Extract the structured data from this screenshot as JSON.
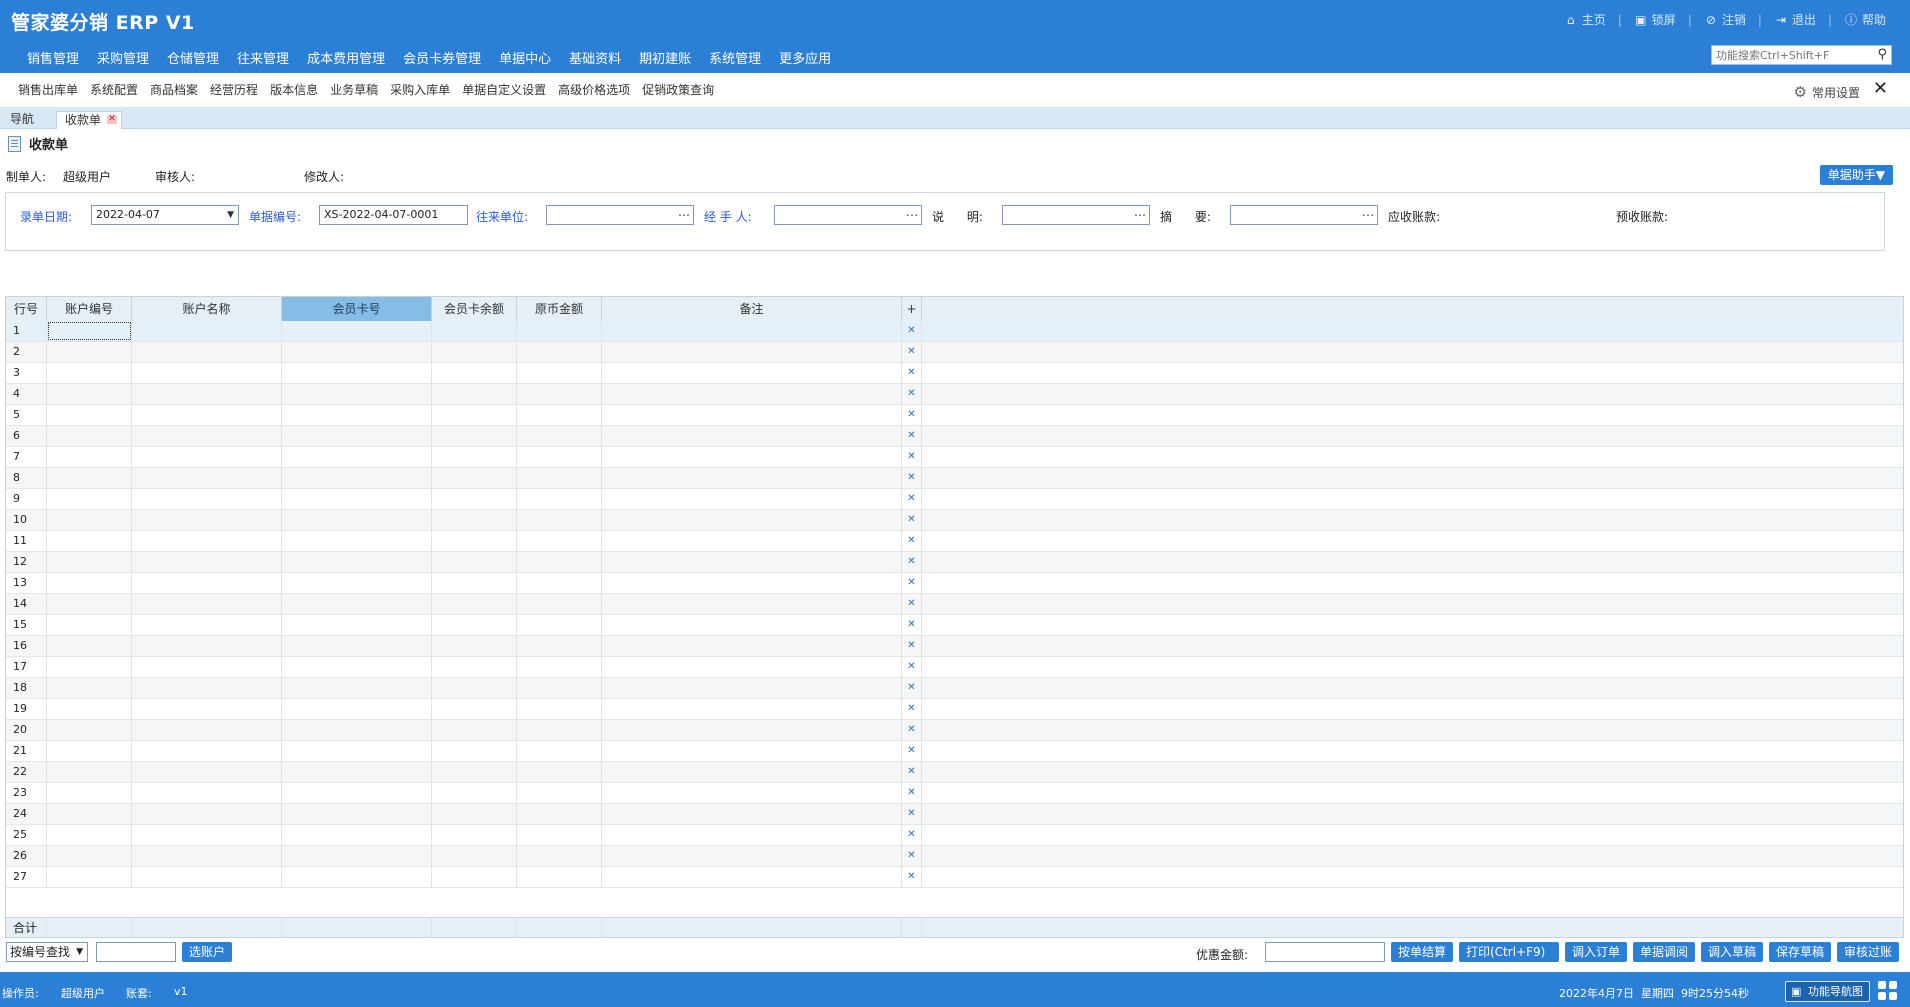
{
  "app": {
    "title": "管家婆分销 ERP V1"
  },
  "top_links": [
    {
      "label": "主页",
      "icon": "home-icon",
      "glyph": "⌂"
    },
    {
      "label": "锁屏",
      "icon": "lock-icon",
      "glyph": "🔒"
    },
    {
      "label": "注销",
      "icon": "logout-icon",
      "glyph": "⊘"
    },
    {
      "label": "退出",
      "icon": "exit-icon",
      "glyph": "⇥"
    },
    {
      "label": "帮助",
      "icon": "help-icon",
      "glyph": "ⓘ"
    }
  ],
  "main_menu": [
    "销售管理",
    "采购管理",
    "仓储管理",
    "往来管理",
    "成本费用管理",
    "会员卡券管理",
    "单据中心",
    "基础资料",
    "期初建账",
    "系统管理",
    "更多应用"
  ],
  "func_search": {
    "placeholder": "功能搜索Ctrl+Shift+F"
  },
  "quick_links": [
    "销售出库单",
    "系统配置",
    "商品档案",
    "经营历程",
    "版本信息",
    "业务草稿",
    "采购入库单",
    "单据自定义设置",
    "高级价格选项",
    "促销政策查询"
  ],
  "common_settings": {
    "label": "常用设置"
  },
  "tabs": {
    "nav": "导航",
    "active": "收款单"
  },
  "doc": {
    "title": "收款单",
    "maker_label": "制单人:",
    "maker_value": "超级用户",
    "auditor_label": "审核人:",
    "modifier_label": "修改人:",
    "helper_button": "单据助手▼"
  },
  "form": {
    "date_label": "录单日期:",
    "date_value": "2022-04-07",
    "number_label": "单据编号:",
    "number_value": "XS-2022-04-07-0001",
    "unit_label": "往来单位:",
    "handler_label": "经 手 人:",
    "note_label": "说      明:",
    "summary_label": "摘      要:",
    "receivable_label": "应收账款:",
    "prereceive_label": "预收账款:"
  },
  "grid": {
    "columns": [
      "行号",
      "账户编号",
      "账户名称",
      "会员卡号",
      "会员卡余额",
      "原币金额",
      "备注",
      "+"
    ],
    "rows": [
      "1",
      "2",
      "3",
      "4",
      "5",
      "6",
      "7",
      "8",
      "9",
      "10",
      "11",
      "12",
      "13",
      "14",
      "15",
      "16",
      "17",
      "18",
      "19",
      "20",
      "21",
      "22",
      "23",
      "24",
      "25",
      "26",
      "27"
    ],
    "delete_glyph": "✕",
    "total_label": "合计"
  },
  "bottom": {
    "lookup_select": "按编号查找",
    "select_account_btn": "选账户",
    "discount_label": "优惠金额:",
    "buttons": [
      "按单结算",
      "打印(Ctrl+F9)",
      "调入订单",
      "单据调阅",
      "调入草稿",
      "保存草稿",
      "审核过账"
    ]
  },
  "status": {
    "operator_label": "操作员:",
    "operator_value": "超级用户",
    "account_label": "账套:",
    "account_value": "v1",
    "datetime": "2022年4月7日  星期四  9时25分54秒",
    "navmap_btn": "功能导航图"
  },
  "colors": {
    "brand": "#2b7fd5",
    "link_blue": "#2a5bd7",
    "selected_header": "#86bde6"
  }
}
